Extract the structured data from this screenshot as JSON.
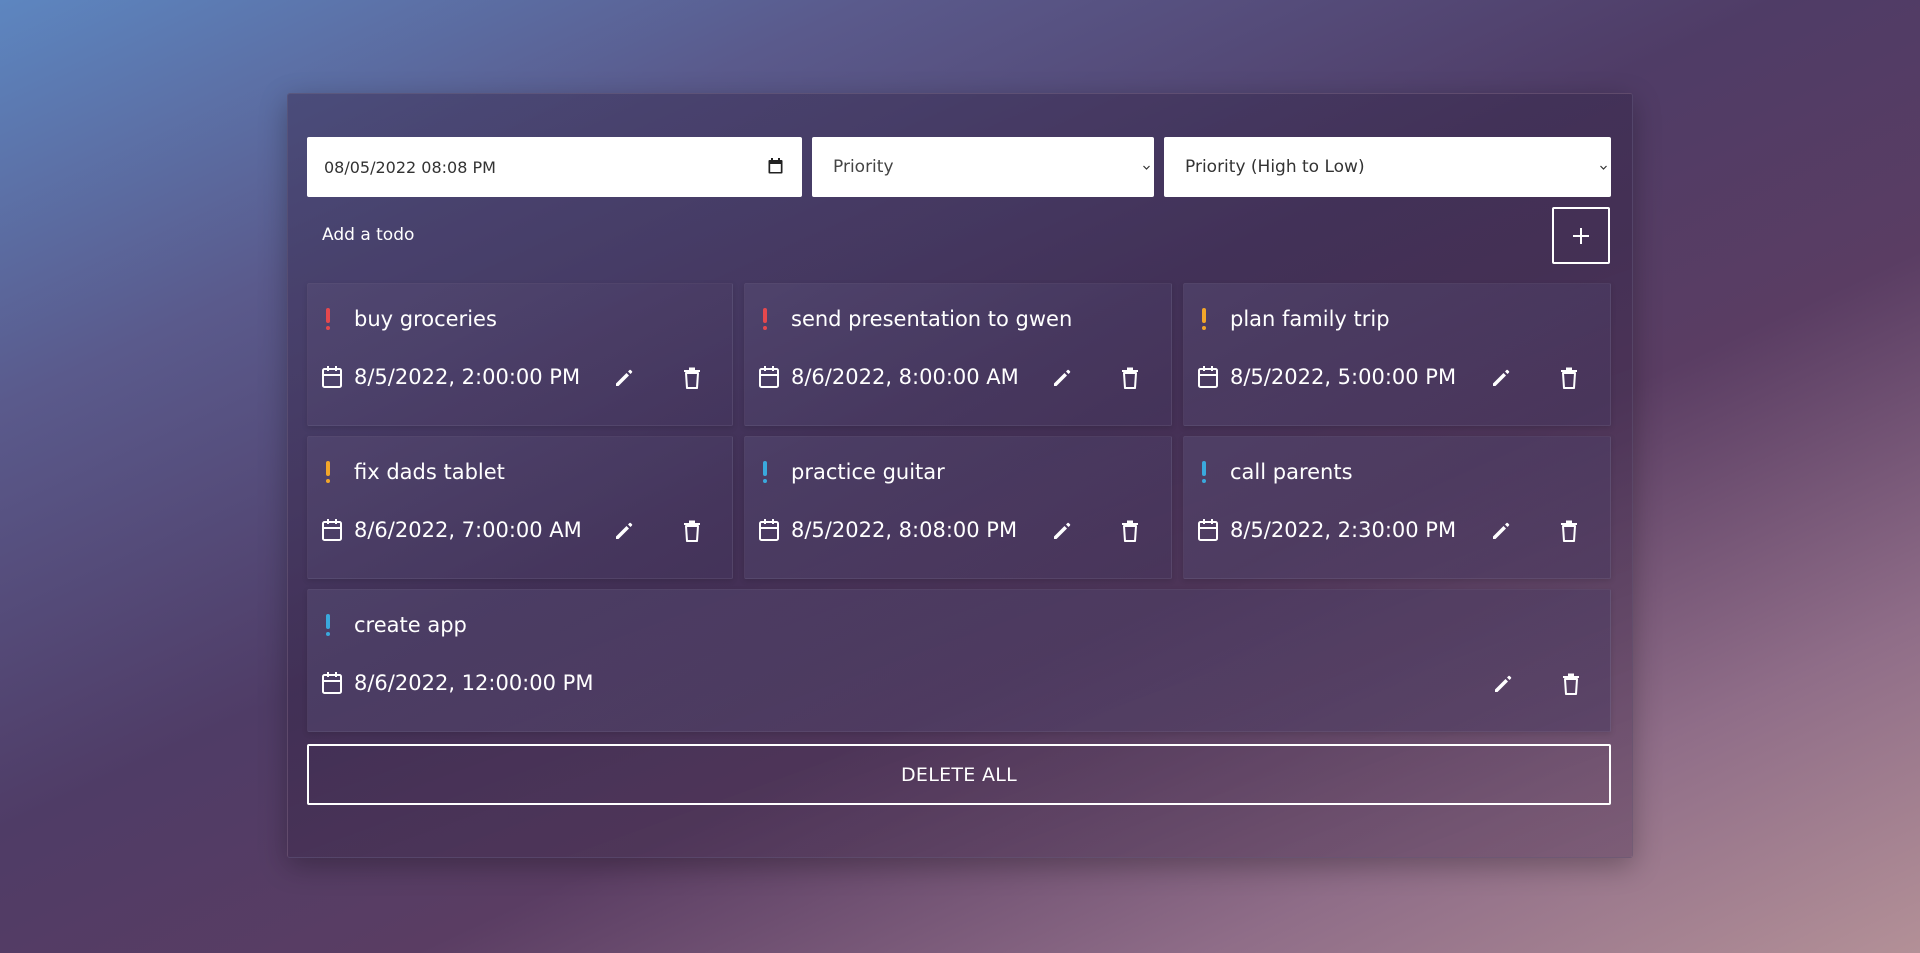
{
  "form": {
    "datetime_value": "08/05/2022 08:08 PM",
    "priority_selected": "Priority",
    "sort_selected": "Priority (High to Low)",
    "add_label": "Add a todo",
    "add_button_icon": "plus-icon"
  },
  "colors": {
    "high": "#e5484d",
    "medium": "#f2a62a",
    "low": "#3aa9dd"
  },
  "todos": [
    {
      "title": "buy groceries",
      "date": "8/5/2022, 2:00:00 PM",
      "priority": "high"
    },
    {
      "title": "send presentation to gwen",
      "date": "8/6/2022, 8:00:00 AM",
      "priority": "high"
    },
    {
      "title": "plan family trip",
      "date": "8/5/2022, 5:00:00 PM",
      "priority": "medium"
    },
    {
      "title": "fix dads tablet",
      "date": "8/6/2022, 7:00:00 AM",
      "priority": "medium"
    },
    {
      "title": "practice guitar",
      "date": "8/5/2022, 8:08:00 PM",
      "priority": "low"
    },
    {
      "title": "call parents",
      "date": "8/5/2022, 2:30:00 PM",
      "priority": "low"
    },
    {
      "title": "create app",
      "date": "8/6/2022, 12:00:00 PM",
      "priority": "low"
    }
  ],
  "delete_all_label": "DELETE ALL"
}
